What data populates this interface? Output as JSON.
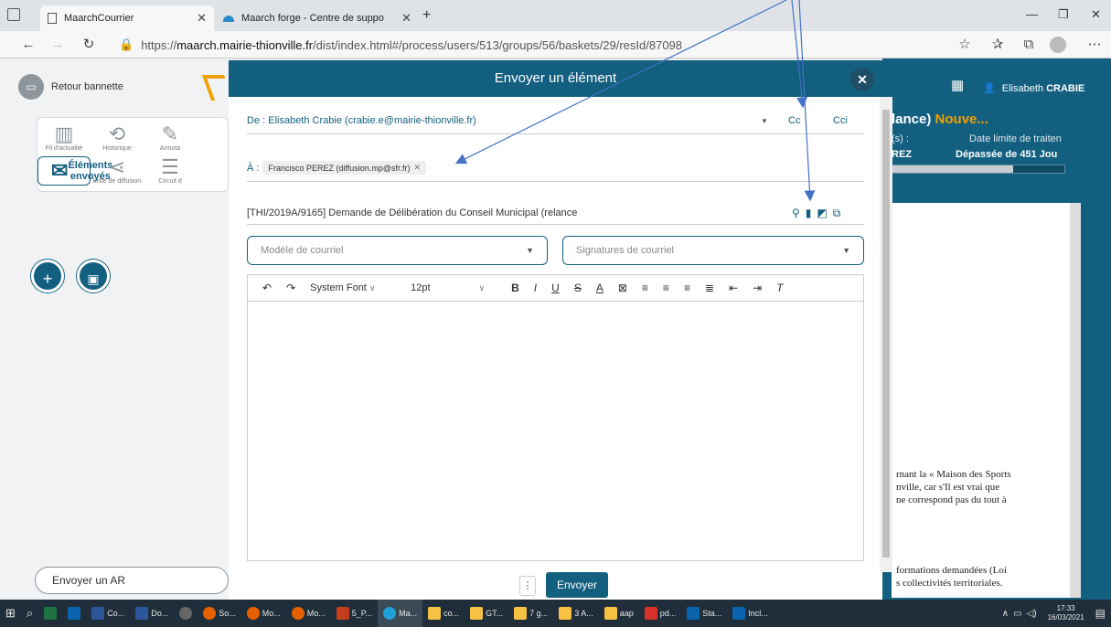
{
  "browser": {
    "tabs": [
      {
        "title": "MaarchCourrier",
        "active": true
      },
      {
        "title": "Maarch forge - Centre de suppo",
        "active": false
      }
    ],
    "new_tab": "+",
    "url_prefix": "https://",
    "url_host": "maarch.mairie-thionville.fr",
    "url_path": "/dist/index.html#/process/users/513/groups/56/baskets/29/resId/87098"
  },
  "left": {
    "back_label": "Retour bannette",
    "menu": [
      {
        "label": "Fil d'actualité",
        "icon": "▥"
      },
      {
        "label": "Historique",
        "icon": "⟲"
      },
      {
        "label": "Annota",
        "icon": "✎"
      },
      {
        "label": "Éléments envoyés",
        "icon": "✉",
        "selected": true
      },
      {
        "label": "Liste de diffusion",
        "icon": "⋖"
      },
      {
        "label": "Circuit d",
        "icon": "☰"
      }
    ],
    "fab_plus": "+",
    "fab_scan": "▣",
    "ar_button": "Envoyer un AR"
  },
  "right": {
    "user_name_first": "Elisabeth",
    "user_name_last": "CRABIE",
    "title_partial": "lance)",
    "title_badge": "Nouve...",
    "col1_label": "(s) :",
    "col1_value": "REZ",
    "col2_label": "Date limite de traiten",
    "col2_value": "Dépassée de 451 Jou",
    "para1_line1": "rnant la « Maison des Sports",
    "para1_line2": "nville, car s'Il est vrai que",
    "para1_line3": "ne correspond pas du tout à",
    "para2_line1": "formations demandées (Loi",
    "para2_line2": "s collectivités territoriales."
  },
  "modal": {
    "title": "Envoyer un élément",
    "from": "De : Elisabeth Crabie (crabie.e@mairie-thionville.fr)",
    "cc": "Cc",
    "cci": "Cci",
    "to_label": "À :",
    "to_chip": "Francisco PEREZ (diffusion.mp@sfr.fr)",
    "subject": "[THI/2019A/9165] Demande de Délibération du Conseil Municipal (relance",
    "template_placeholder": "Modèle de courriel",
    "signature_placeholder": "Signatures de courriel",
    "font_name": "System Font",
    "font_size": "12pt",
    "send_label": "Envoyer",
    "more": "⋮"
  },
  "taskbar": {
    "items": [
      "Co...",
      "Do...",
      "So...",
      "Mo...",
      "Mo...",
      "5_P...",
      "Ma...",
      "co...",
      "GT...",
      "7 g...",
      "3 A...",
      "aap",
      "pd...",
      "Sta...",
      "Incl..."
    ],
    "time": "17:33",
    "date": "16/03/2021"
  },
  "colors": {
    "brand": "#135f7f",
    "annotation": "#4472c4"
  }
}
